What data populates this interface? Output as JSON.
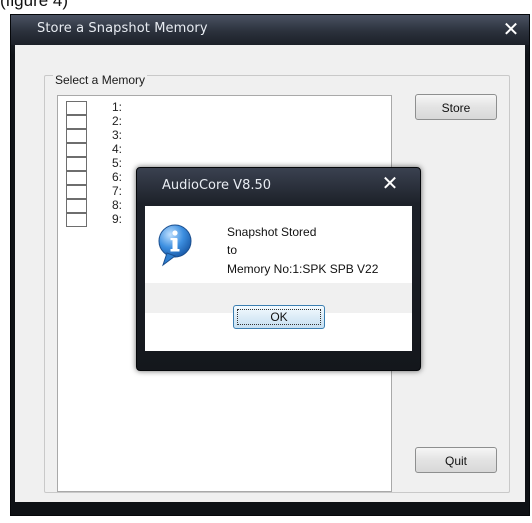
{
  "top_caption": "(figure 4)",
  "main_window": {
    "title": "Store a Snapshot Memory",
    "close_glyph": "✕",
    "group_label": "Select a Memory",
    "memories": [
      {
        "label": "1:"
      },
      {
        "label": "2:"
      },
      {
        "label": "3:"
      },
      {
        "label": "4:"
      },
      {
        "label": "5:"
      },
      {
        "label": "6:"
      },
      {
        "label": "7:"
      },
      {
        "label": "8:"
      },
      {
        "label": "9:"
      }
    ],
    "store_button": "Store",
    "quit_button": "Quit"
  },
  "message_box": {
    "title": "AudioCore V8.50",
    "close_glyph": "✕",
    "icon": "info-icon",
    "lines": [
      "Snapshot Stored",
      "to",
      "Memory No:1:SPK SPB V22"
    ],
    "ok_button": "OK"
  },
  "colors": {
    "titlebar": "#1d2129",
    "client_bg": "#f0f0f0",
    "info_icon": "#2f7fd0"
  }
}
